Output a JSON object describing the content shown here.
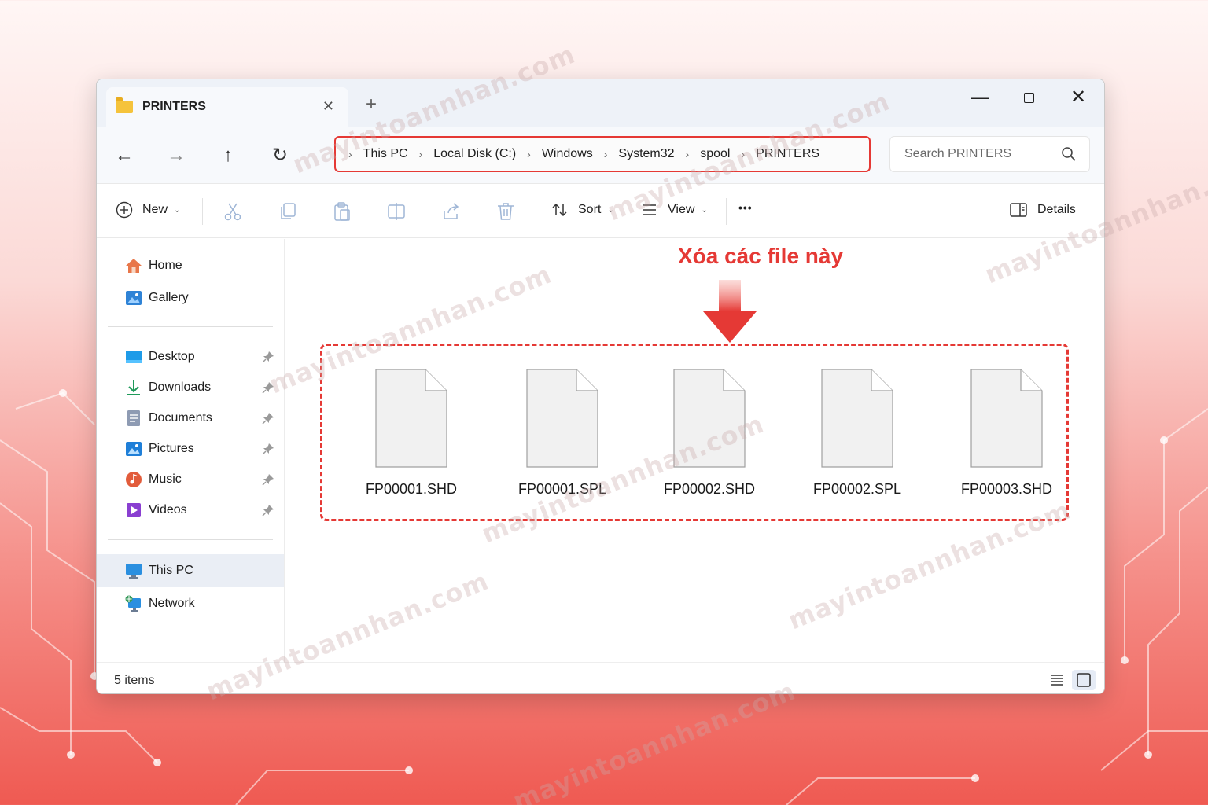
{
  "watermark_text": "mayintoannhan.com",
  "window": {
    "tab_title": "PRINTERS",
    "tab_close": "✕",
    "new_tab": "+",
    "controls": {
      "minimize": "—",
      "close": "✕"
    }
  },
  "nav": {
    "back": "←",
    "forward": "→",
    "up": "↑",
    "refresh": "↻",
    "breadcrumb": [
      "This PC",
      "Local Disk (C:)",
      "Windows",
      "System32",
      "spool",
      "PRINTERS"
    ],
    "search_placeholder": "Search PRINTERS"
  },
  "toolbar": {
    "new_label": "New",
    "sort_label": "Sort",
    "view_label": "View",
    "more": "•••",
    "details_label": "Details"
  },
  "sidebar": {
    "group1": [
      {
        "label": "Home",
        "icon": "home-icon"
      },
      {
        "label": "Gallery",
        "icon": "gallery-icon"
      }
    ],
    "group2": [
      {
        "label": "Desktop",
        "icon": "desktop-icon"
      },
      {
        "label": "Downloads",
        "icon": "downloads-icon"
      },
      {
        "label": "Documents",
        "icon": "documents-icon"
      },
      {
        "label": "Pictures",
        "icon": "pictures-icon"
      },
      {
        "label": "Music",
        "icon": "music-icon"
      },
      {
        "label": "Videos",
        "icon": "videos-icon"
      }
    ],
    "group3": [
      {
        "label": "This PC",
        "icon": "this-pc-icon",
        "active": true
      },
      {
        "label": "Network",
        "icon": "network-icon"
      }
    ]
  },
  "content": {
    "annotation": "Xóa các file này",
    "annotation_color": "#e53935",
    "files": [
      "FP00001.SHD",
      "FP00001.SPL",
      "FP00002.SHD",
      "FP00002.SPL",
      "FP00003.SHD"
    ]
  },
  "status": {
    "items_text": "5 items"
  }
}
